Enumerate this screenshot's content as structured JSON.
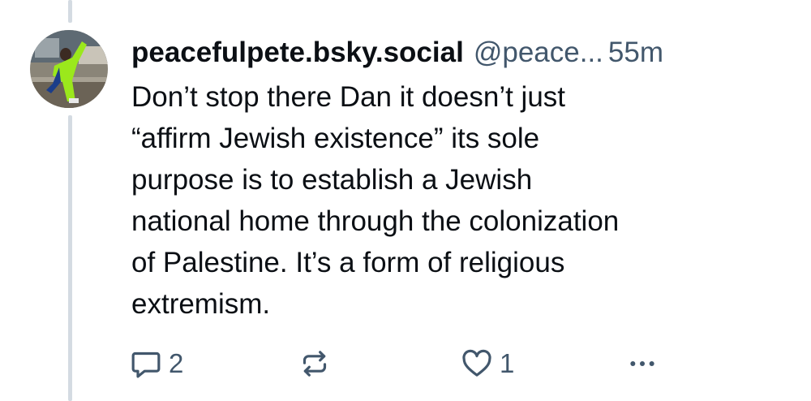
{
  "post": {
    "display_name": "peacefulpete.bsky.social",
    "handle": "@peace...",
    "time": "55m",
    "avatar_icon": "user-avatar-photo",
    "text_lines": [
      "Don’t stop there Dan it doesn’t just",
      "“affirm Jewish existence” its sole",
      "purpose is to establish a Jewish",
      "national home through the colonization",
      "of Palestine. It’s a form of religious",
      "extremism."
    ]
  },
  "actions": {
    "reply_icon": "reply-bubble-icon",
    "reply_count": "2",
    "repost_icon": "repost-icon",
    "like_icon": "heart-icon",
    "like_count": "1",
    "more_icon": "more-dots-icon"
  },
  "colors": {
    "text": "#0b0f14",
    "muted": "#42576c",
    "thread_line": "#d4dbe2",
    "background": "#ffffff"
  }
}
